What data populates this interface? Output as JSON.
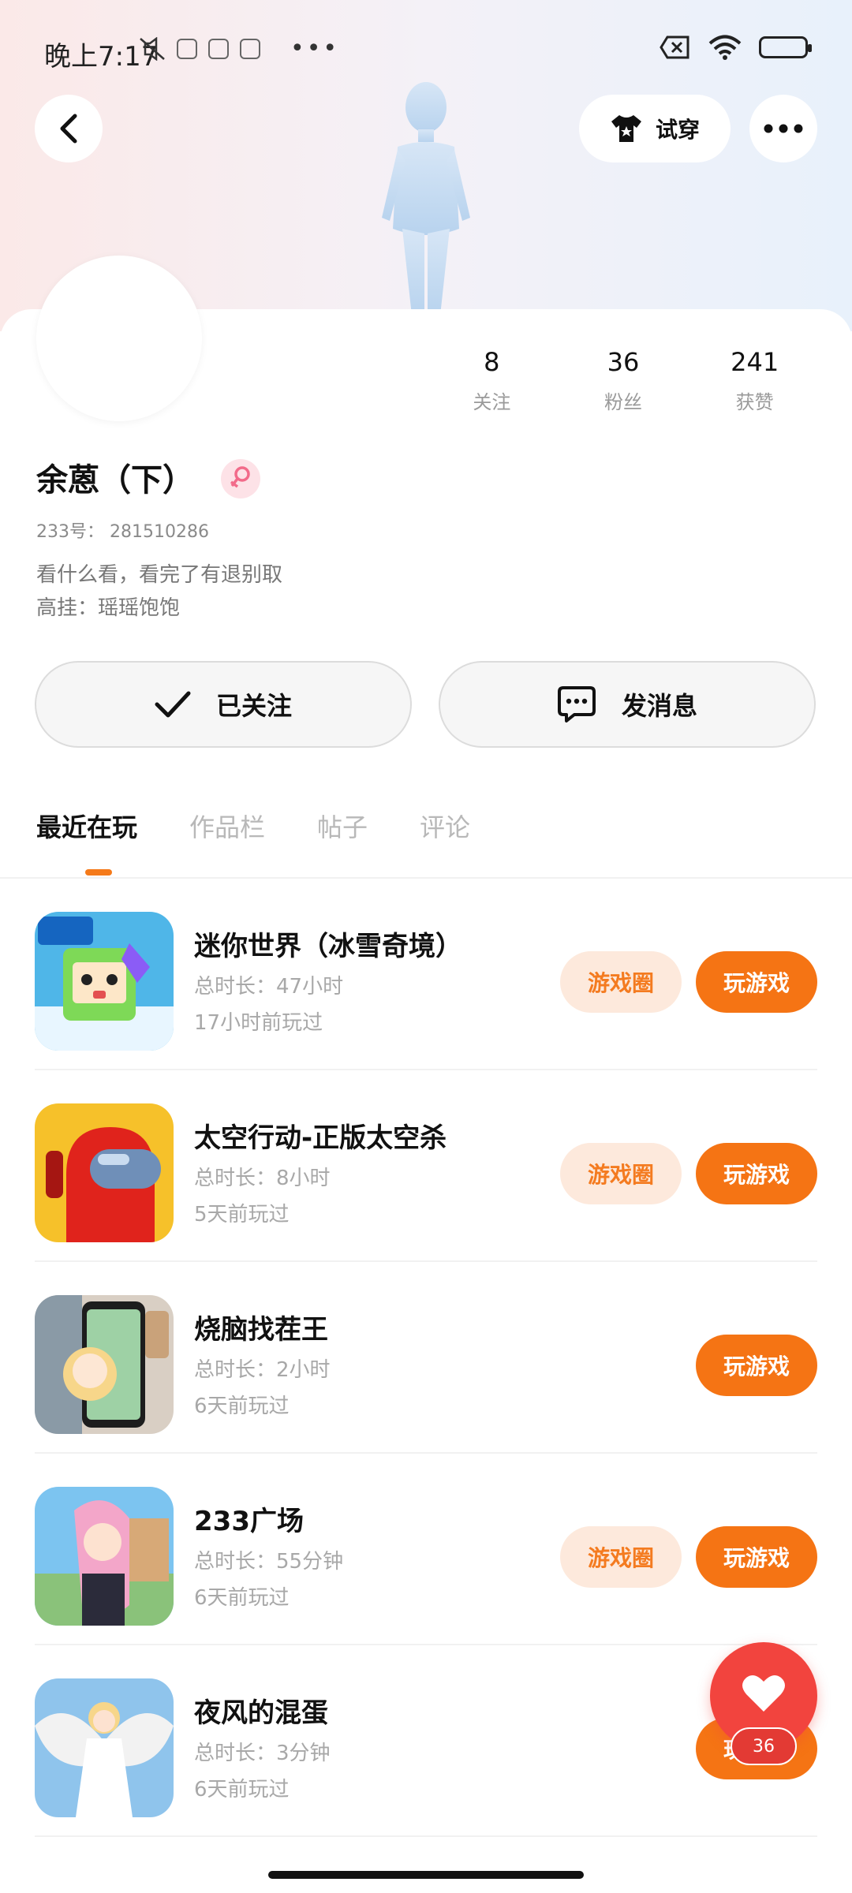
{
  "status_bar": {
    "time": "晚上7:17",
    "overflow_dots": "•••"
  },
  "header": {
    "try_on_label": "试穿"
  },
  "profile": {
    "name": "余蒽（下）",
    "uid_label": "233号：",
    "uid_value": "281510286",
    "bio_line1": "看什么看，看完了有退别取",
    "bio_line2": "高挂：瑶瑶饱饱",
    "gender": "female"
  },
  "stats": [
    {
      "value": "8",
      "label": "关注"
    },
    {
      "value": "36",
      "label": "粉丝"
    },
    {
      "value": "241",
      "label": "获赞"
    }
  ],
  "actions": {
    "follow_label": "已关注",
    "message_label": "发消息"
  },
  "tabs": [
    {
      "label": "最近在玩",
      "active": true
    },
    {
      "label": "作品栏",
      "active": false
    },
    {
      "label": "帖子",
      "active": false
    },
    {
      "label": "评论",
      "active": false
    }
  ],
  "games": [
    {
      "name": "迷你世界（冰雪奇境）",
      "duration": "总时长：47小时",
      "last_played": "17小时前玩过",
      "has_circle": true,
      "icon": "mini-world-game-icon"
    },
    {
      "name": "太空行动-正版太空杀",
      "duration": "总时长：8小时",
      "last_played": "5天前玩过",
      "has_circle": true,
      "icon": "space-action-game-icon"
    },
    {
      "name": "烧脑找茬王",
      "duration": "总时长：2小时",
      "last_played": "6天前玩过",
      "has_circle": false,
      "icon": "brain-game-icon"
    },
    {
      "name": "233广场",
      "duration": "总时长：55分钟",
      "last_played": "6天前玩过",
      "has_circle": true,
      "icon": "plaza-game-icon"
    },
    {
      "name": "夜风的混蛋",
      "duration": "总时长：3分钟",
      "last_played": "6天前玩过",
      "has_circle": false,
      "icon": "angel-game-icon"
    }
  ],
  "buttons": {
    "circle_label": "游戏圈",
    "play_label": "玩游戏"
  },
  "like_fab": {
    "count": "36"
  },
  "colors": {
    "accent": "#f57414",
    "accent_light": "#fde9dc",
    "like_red": "#f2443e"
  }
}
